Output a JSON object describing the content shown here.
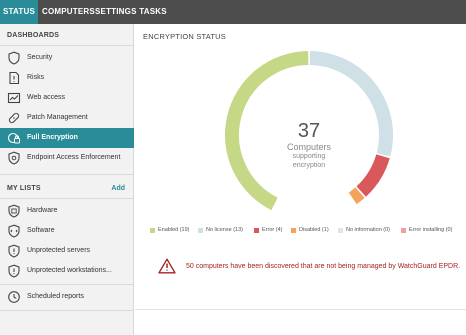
{
  "topbar": {
    "tabs": [
      {
        "label": "STATUS",
        "active": true
      },
      {
        "label": "COMPUTERS",
        "active": false
      },
      {
        "label": "SETTINGS",
        "active": false
      },
      {
        "label": "TASKS",
        "active": false
      }
    ]
  },
  "sidebar": {
    "dashboards_heading": "DASHBOARDS",
    "dashboards": [
      {
        "label": "Security",
        "icon": "shield-icon"
      },
      {
        "label": "Risks",
        "icon": "document-warning-icon"
      },
      {
        "label": "Web access",
        "icon": "chart-line-icon"
      },
      {
        "label": "Patch Management",
        "icon": "bandage-icon"
      },
      {
        "label": "Full Encryption",
        "icon": "encryption-icon",
        "active": true
      },
      {
        "label": "Endpoint Access Enforcement",
        "icon": "shield-gear-icon"
      }
    ],
    "lists_heading": "MY LISTS",
    "add_label": "Add",
    "lists": [
      {
        "label": "Hardware",
        "icon": "hardware-icon"
      },
      {
        "label": "Software",
        "icon": "software-icon"
      },
      {
        "label": "Unprotected servers",
        "icon": "shield-warning-icon"
      },
      {
        "label": "Unprotected workstations...",
        "icon": "shield-warning-icon"
      },
      {
        "label": "Scheduled reports",
        "icon": "clock-icon"
      }
    ]
  },
  "panel": {
    "title": "ENCRYPTION STATUS",
    "center": {
      "number": "37",
      "line1": "Computers",
      "line2": "supporting",
      "line3": "encryption"
    },
    "legend": [
      {
        "label": "Enabled (19)",
        "color": "#c5d886"
      },
      {
        "label": "No license (13)",
        "color": "#cfe0e6"
      },
      {
        "label": "Error (4)",
        "color": "#d9585c"
      },
      {
        "label": "Disabled (1)",
        "color": "#f3a35a"
      },
      {
        "label": "No information (0)",
        "color": "#e1e4e6"
      },
      {
        "label": "Error installing (0)",
        "color": "#f0a0a0"
      }
    ],
    "warning": "50 computers have been discovered that are not being managed by WatchGuard EPDR."
  },
  "chart_data": {
    "type": "pie",
    "categories": [
      "Enabled",
      "No license",
      "Error",
      "Disabled",
      "No information",
      "Error installing"
    ],
    "values": [
      19,
      13,
      4,
      1,
      0,
      0
    ],
    "colors": [
      "#c5d886",
      "#cfe0e6",
      "#d9585c",
      "#f3a35a",
      "#e1e4e6",
      "#f0a0a0"
    ],
    "total": 37
  }
}
